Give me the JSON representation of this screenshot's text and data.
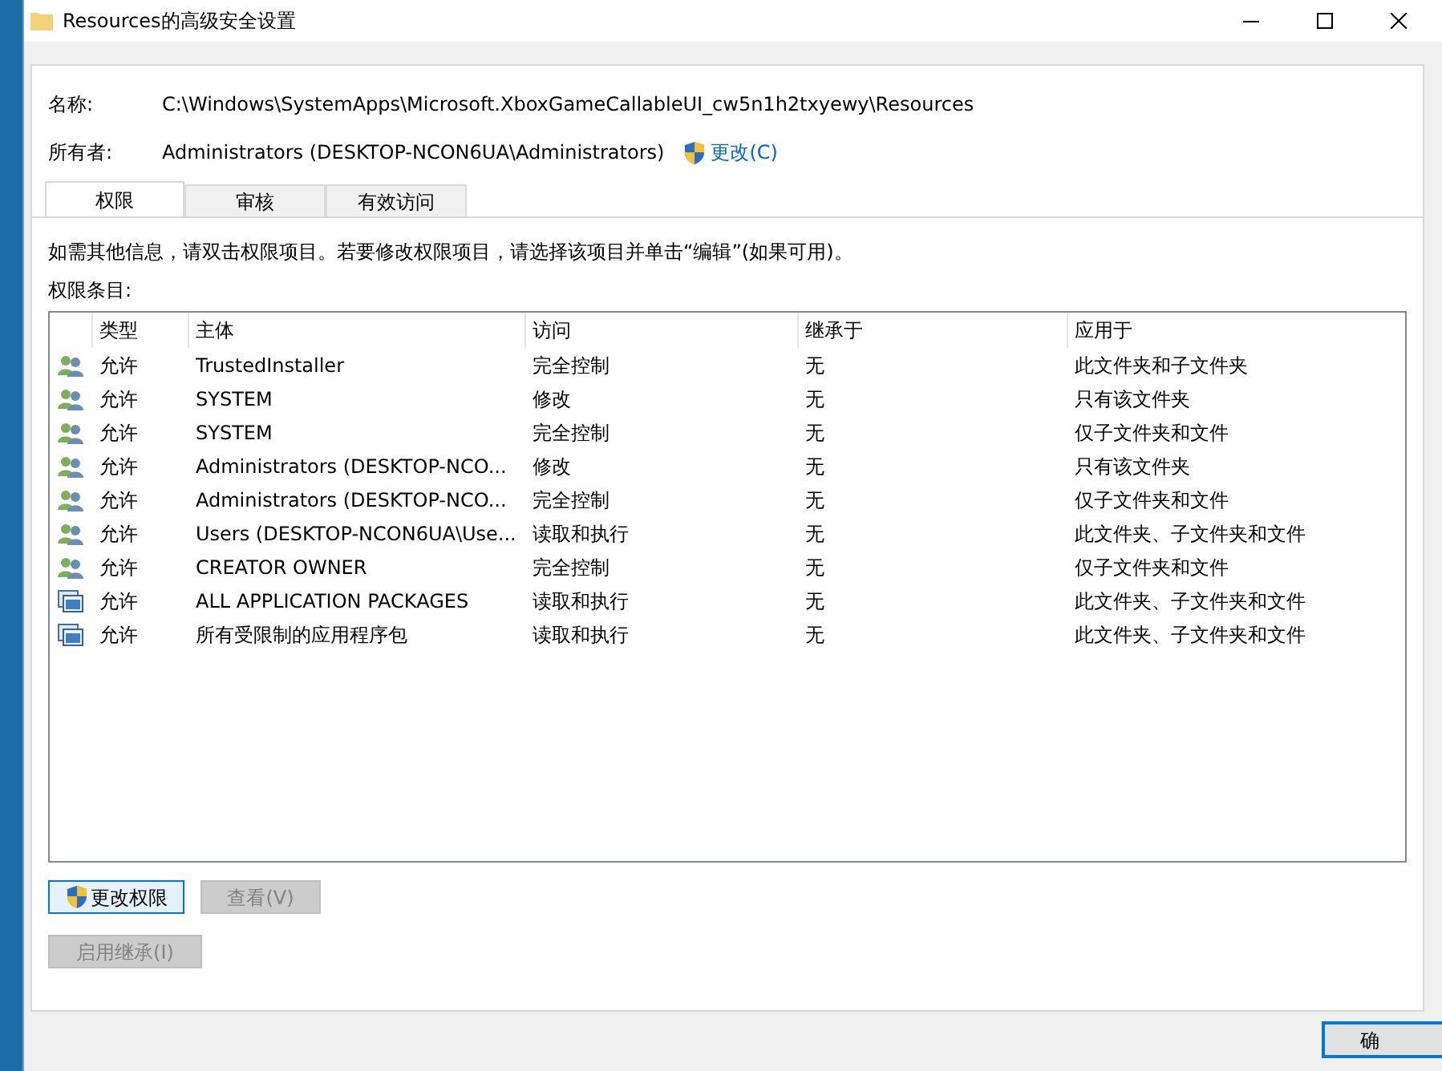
{
  "window": {
    "title": "Resources的高级安全设置"
  },
  "name_label": "名称:",
  "name_value": "C:\\Windows\\SystemApps\\Microsoft.XboxGameCallableUI_cw5n1h2txyewy\\Resources",
  "owner_label": "所有者:",
  "owner_value": "Administrators (DESKTOP-NCON6UA\\Administrators)",
  "owner_change_link": "更改(C)",
  "tabs": [
    {
      "label": "权限",
      "selected": true
    },
    {
      "label": "审核",
      "selected": false
    },
    {
      "label": "有效访问",
      "selected": false
    }
  ],
  "info_text": "如需其他信息，请双击权限项目。若要修改权限项目，请选择该项目并单击“编辑”(如果可用)。",
  "entries_label": "权限条目:",
  "table": {
    "columns": [
      "类型",
      "主体",
      "访问",
      "继承于",
      "应用于"
    ],
    "rows": [
      {
        "kind": "user",
        "cells": [
          "允许",
          "TrustedInstaller",
          "完全控制",
          "无",
          "此文件夹和子文件夹"
        ]
      },
      {
        "kind": "user",
        "cells": [
          "允许",
          "SYSTEM",
          "修改",
          "无",
          "只有该文件夹"
        ]
      },
      {
        "kind": "user",
        "cells": [
          "允许",
          "SYSTEM",
          "完全控制",
          "无",
          "仅子文件夹和文件"
        ]
      },
      {
        "kind": "user",
        "cells": [
          "允许",
          "Administrators (DESKTOP-NCO...",
          "修改",
          "无",
          "只有该文件夹"
        ]
      },
      {
        "kind": "user",
        "cells": [
          "允许",
          "Administrators (DESKTOP-NCO...",
          "完全控制",
          "无",
          "仅子文件夹和文件"
        ]
      },
      {
        "kind": "user",
        "cells": [
          "允许",
          "Users (DESKTOP-NCON6UA\\Use...",
          "读取和执行",
          "无",
          "此文件夹、子文件夹和文件"
        ]
      },
      {
        "kind": "user",
        "cells": [
          "允许",
          "CREATOR OWNER",
          "完全控制",
          "无",
          "仅子文件夹和文件"
        ]
      },
      {
        "kind": "package",
        "cells": [
          "允许",
          "ALL APPLICATION PACKAGES",
          "读取和执行",
          "无",
          "此文件夹、子文件夹和文件"
        ]
      },
      {
        "kind": "package",
        "cells": [
          "允许",
          "所有受限制的应用程序包",
          "读取和执行",
          "无",
          "此文件夹、子文件夹和文件"
        ]
      }
    ]
  },
  "buttons": [
    {
      "label": "更改权限",
      "disabled": false,
      "shield": true
    },
    {
      "label": "查看(V)",
      "disabled": true,
      "shield": false
    }
  ],
  "inherit_button": {
    "label": "启用继承(I)",
    "disabled": true
  },
  "ok_button": {
    "label": "确"
  }
}
